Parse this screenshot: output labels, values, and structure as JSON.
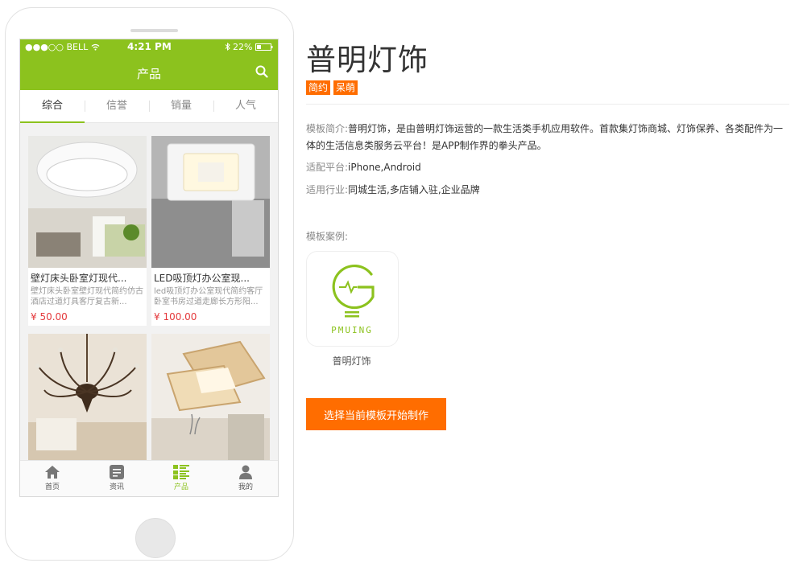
{
  "phone": {
    "status": {
      "carrier": "●●●○○ BELL",
      "time": "4:21 PM",
      "battery": "22%"
    },
    "nav_title": "产品",
    "tabs": [
      "综合",
      "信誉",
      "销量",
      "人气"
    ],
    "products": [
      {
        "name": "壁灯床头卧室灯现代...",
        "desc": "壁灯床头卧室壁灯现代简约仿古酒店过道灯具客厅复古新...",
        "price": "¥ 50.00"
      },
      {
        "name": "LED吸顶灯办公室现...",
        "desc": "led吸顶灯办公室现代简约客厅卧室书房过道走廊长方形阳...",
        "price": "¥ 100.00"
      },
      {
        "name": "",
        "desc": "",
        "price": ""
      },
      {
        "name": "",
        "desc": "",
        "price": ""
      }
    ],
    "bottom_nav": [
      {
        "label": "首页",
        "icon": "home-icon"
      },
      {
        "label": "资讯",
        "icon": "news-icon"
      },
      {
        "label": "产品",
        "icon": "product-grid-icon"
      },
      {
        "label": "我的",
        "icon": "user-icon"
      }
    ]
  },
  "app": {
    "title": "普明灯饰",
    "tags": [
      "简约",
      "呆萌"
    ],
    "intro_label": "模板简介:",
    "intro": "普明灯饰，是由普明灯饰运营的一款生活类手机应用软件。首款集灯饰商城、灯饰保养、各类配件为一体的生活信息类服务云平台！是APP制作界的拳头产品。",
    "platform_label": "适配平台:",
    "platform": "iPhone,Android",
    "industry_label": "适用行业:",
    "industry": "同城生活,多店铺入驻,企业品牌",
    "case_label": "模板案例:",
    "case_logo_text": "PMUING",
    "case_name": "普明灯饰",
    "cta_label": "选择当前模板开始制作"
  },
  "colors": {
    "brand_green": "#8cc21e",
    "accent_orange": "#ff6d00",
    "price_red": "#e4393c"
  }
}
